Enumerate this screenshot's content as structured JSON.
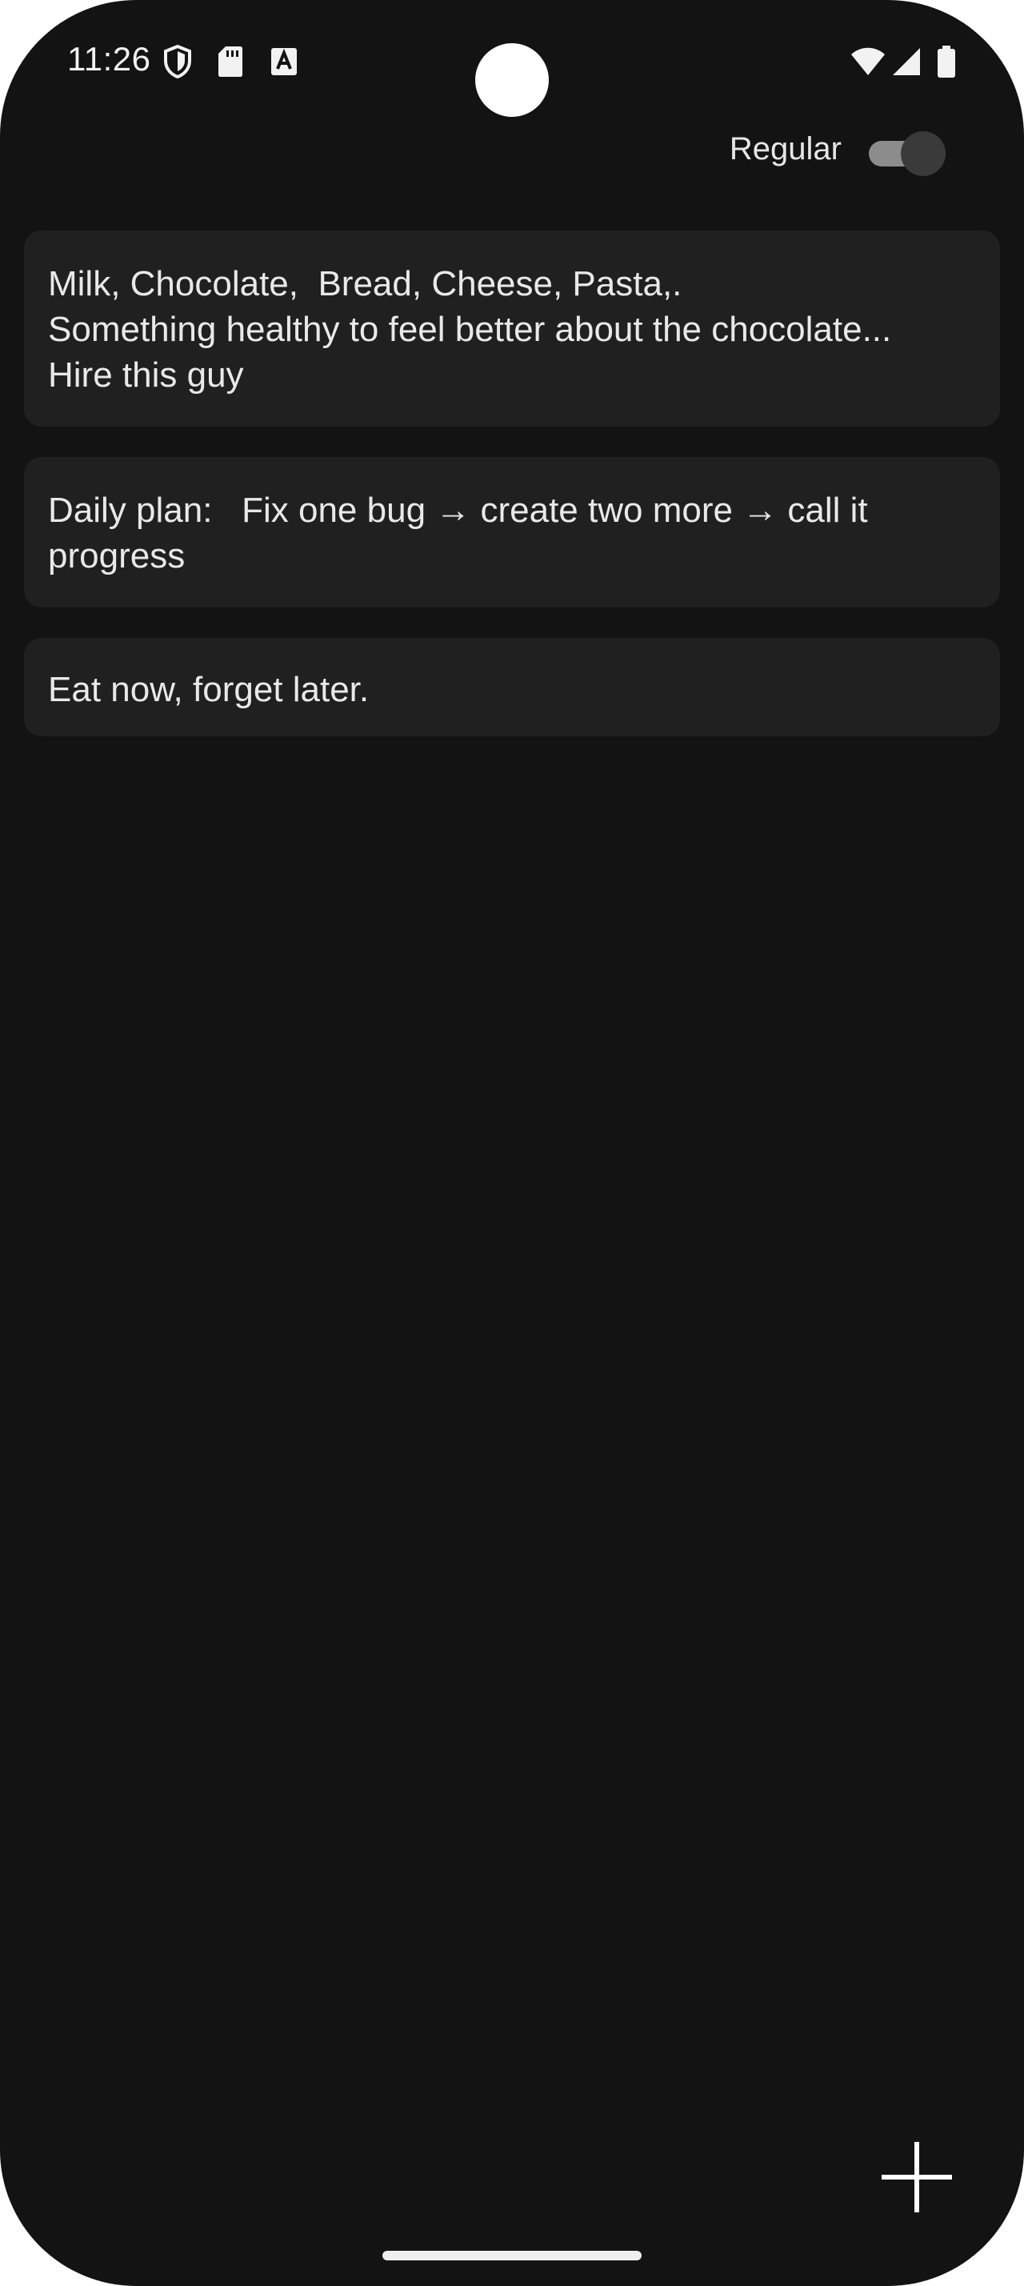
{
  "status_bar": {
    "time": "11:26",
    "left_icons": [
      "shield-icon",
      "sd-card-icon",
      "font-a-icon"
    ],
    "right_icons": [
      "wifi-icon",
      "signal-icon",
      "battery-icon"
    ]
  },
  "header": {
    "toggle_label": "Regular",
    "toggle_on": false
  },
  "notes": [
    {
      "text": "Milk, Chocolate,  Bread, Cheese, Pasta,.\nSomething healthy to feel better about the chocolate...\nHire this guy"
    },
    {
      "text": "Daily plan:   Fix one bug → create two more → call it progress"
    },
    {
      "text": "Eat now, forget later."
    }
  ],
  "fab": {
    "icon": "plus-icon"
  },
  "colors": {
    "background": "#131313",
    "card": "#202020",
    "text": "#e9e9e9"
  }
}
